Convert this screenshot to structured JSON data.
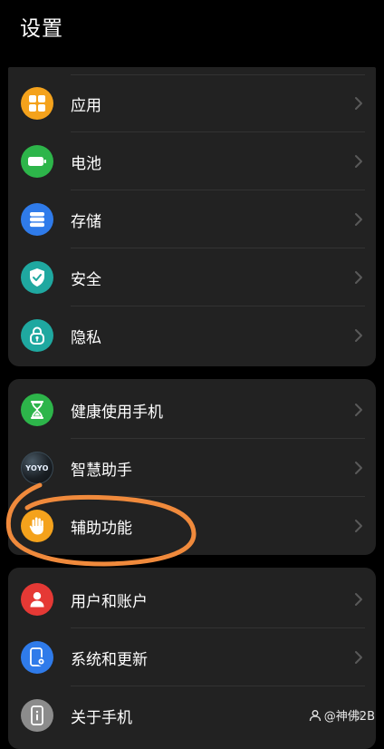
{
  "header": {
    "title": "设置"
  },
  "groups": [
    {
      "items": [
        {
          "label": "应用",
          "icon": "apps-grid-icon",
          "color": "#F4A21C"
        },
        {
          "label": "电池",
          "icon": "battery-icon",
          "color": "#2DB54A"
        },
        {
          "label": "存储",
          "icon": "storage-icon",
          "color": "#2F7BEA"
        },
        {
          "label": "安全",
          "icon": "shield-icon",
          "color": "#1FA8A0"
        },
        {
          "label": "隐私",
          "icon": "privacy-lock-icon",
          "color": "#1FA8A0"
        }
      ]
    },
    {
      "items": [
        {
          "label": "健康使用手机",
          "icon": "hourglass-icon",
          "color": "#2DB54A"
        },
        {
          "label": "智慧助手",
          "icon": "yoyo-icon",
          "icon_text": "YOYO",
          "color": "#1a1a1a"
        },
        {
          "label": "辅助功能",
          "icon": "hand-icon",
          "color": "#F4A21C"
        }
      ]
    },
    {
      "items": [
        {
          "label": "用户和账户",
          "icon": "user-icon",
          "color": "#E53935"
        },
        {
          "label": "系统和更新",
          "icon": "phone-update-icon",
          "color": "#2F7BEA"
        },
        {
          "label": "关于手机",
          "icon": "phone-info-icon",
          "color": "#8C8C8C"
        }
      ]
    }
  ],
  "annotation": {
    "color": "#F08A3C"
  },
  "watermark": {
    "text": "@神佛2B"
  }
}
